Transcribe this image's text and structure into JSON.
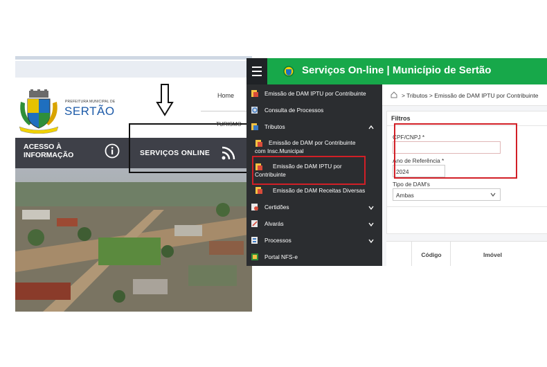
{
  "site": {
    "logo_small": "PREFEITURA MUNICIPAL DE",
    "logo_big": "SERTÃO",
    "nav_home": "Home",
    "nav_turismo": "TURISMO",
    "acesso_line1": "ACESSO À",
    "acesso_line2": "INFORMAÇÃO",
    "servicos_online": "SERVIÇOS ONLINE",
    "icons": [
      "coat-of-arms-icon",
      "info-icon",
      "rss-icon"
    ]
  },
  "app": {
    "title": "Serviços On-line | Município de Sertão",
    "accent": "#17a84a",
    "sidebar_bg": "#2b2d30",
    "sidebar": {
      "items": [
        {
          "label": "Emissão de DAM IPTU por Contribuinte"
        },
        {
          "label": "Consulta de Processos"
        },
        {
          "label": "Tributos"
        },
        {
          "label_line1": "Emissão de DAM por Contribuinte",
          "label_line2": "com Insc.Municipal"
        },
        {
          "label_line1": "Emissão de DAM IPTU por",
          "label_line2": "Contribuinte"
        },
        {
          "label": "Emissão de DAM Receitas Diversas"
        },
        {
          "label": "Certidões"
        },
        {
          "label": "Alvarás"
        },
        {
          "label": "Processos"
        },
        {
          "label": "Portal NFS-e"
        }
      ]
    },
    "breadcrumb": "> Tributos > Emissão de DAM IPTU por Contribuinte",
    "filters": {
      "title": "Filtros",
      "cpf_label": "CPF/CNPJ *",
      "cpf_value": "",
      "ano_label": "Ano de Referência *",
      "ano_value": "2024",
      "tipo_label": "Tipo de DAM's",
      "tipo_value": "Ambas"
    },
    "table": {
      "columns": [
        "Código",
        "Imóvel"
      ]
    }
  },
  "annotation_colors": {
    "highlight": "#d21f26",
    "arrow": "#111111"
  }
}
